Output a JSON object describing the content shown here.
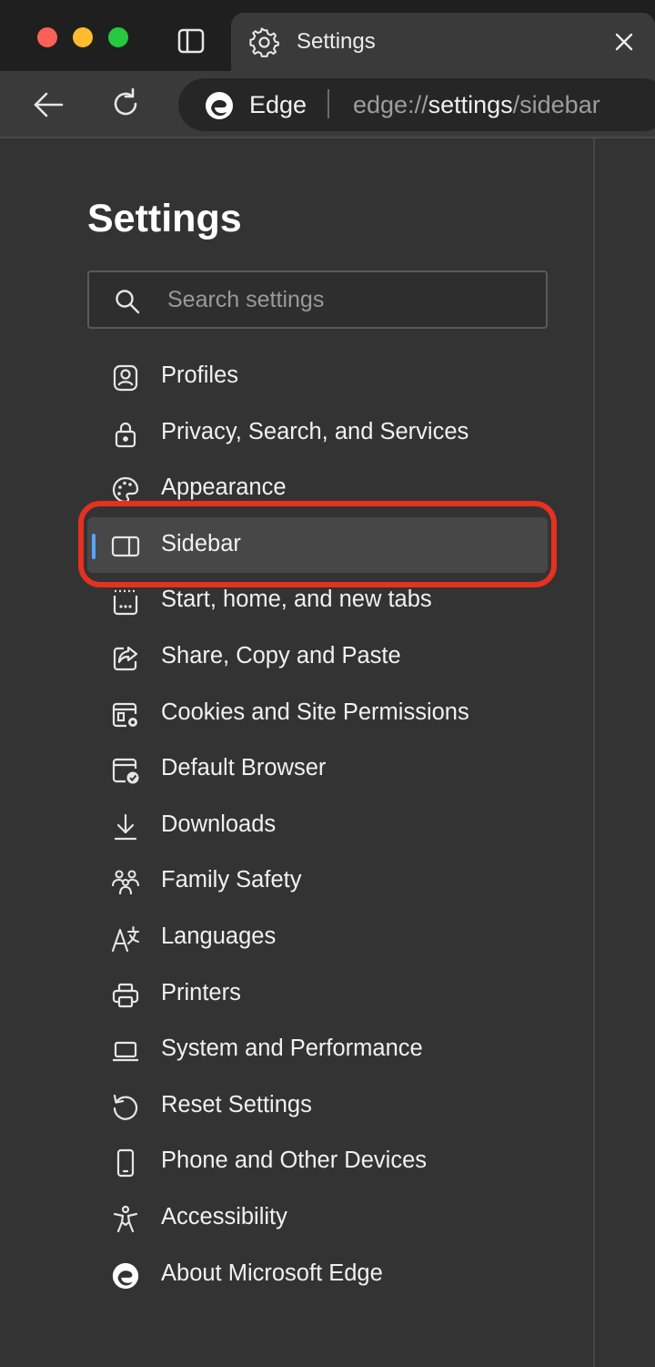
{
  "window": {
    "traffic_lights": [
      "close",
      "minimize",
      "zoom"
    ]
  },
  "tab": {
    "title": "Settings",
    "icon": "gear-icon"
  },
  "toolbar": {
    "site_label": "Edge",
    "url_scheme": "edge://",
    "url_host": "settings",
    "url_slash": "/",
    "url_path": "sidebar"
  },
  "settings": {
    "title": "Settings",
    "search_placeholder": "Search settings",
    "items": [
      {
        "label": "Profiles",
        "icon": "profile-icon"
      },
      {
        "label": "Privacy, Search, and Services",
        "icon": "lock-icon"
      },
      {
        "label": "Appearance",
        "icon": "palette-icon"
      },
      {
        "label": "Sidebar",
        "icon": "sidebar-icon",
        "active": true
      },
      {
        "label": "Start, home, and new tabs",
        "icon": "new-tab-icon"
      },
      {
        "label": "Share, Copy and Paste",
        "icon": "share-icon"
      },
      {
        "label": "Cookies and Site Permissions",
        "icon": "cookie-permissions-icon"
      },
      {
        "label": "Default Browser",
        "icon": "default-browser-icon"
      },
      {
        "label": "Downloads",
        "icon": "download-icon"
      },
      {
        "label": "Family Safety",
        "icon": "family-icon"
      },
      {
        "label": "Languages",
        "icon": "language-icon"
      },
      {
        "label": "Printers",
        "icon": "printer-icon"
      },
      {
        "label": "System and Performance",
        "icon": "laptop-icon"
      },
      {
        "label": "Reset Settings",
        "icon": "reset-icon"
      },
      {
        "label": "Phone and Other Devices",
        "icon": "phone-icon"
      },
      {
        "label": "Accessibility",
        "icon": "accessibility-icon"
      },
      {
        "label": "About Microsoft Edge",
        "icon": "edge-logo-icon"
      }
    ]
  },
  "colors": {
    "accent": "#5aa2ff",
    "highlight_ring": "#e43120",
    "background": "#333333"
  }
}
